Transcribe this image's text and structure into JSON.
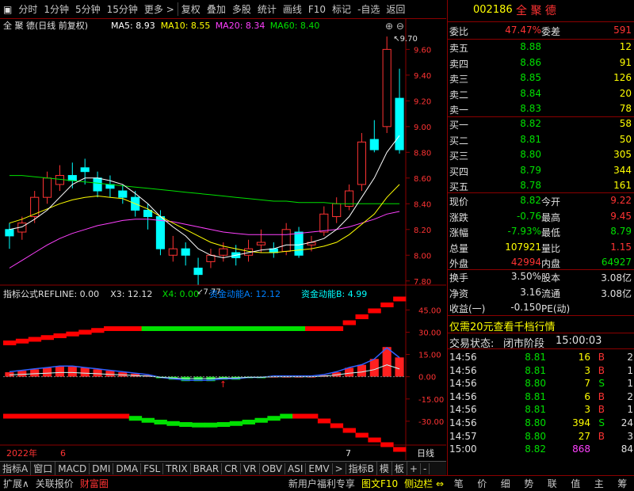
{
  "toolbar": {
    "items": [
      "分时",
      "1分钟",
      "5分钟",
      "15分钟",
      "更多 >",
      "复权",
      "叠加",
      "多股",
      "统计",
      "画线",
      "F10",
      "标记",
      "-自选",
      "返回"
    ]
  },
  "chart": {
    "name": "全 聚 德(日线 前复权)",
    "ma": [
      {
        "label": "MA5: 8.93",
        "color": "#ffffff"
      },
      {
        "label": "MA10: 8.55",
        "color": "#ffff00"
      },
      {
        "label": "MA20: 8.34",
        "color": "#ff40ff"
      },
      {
        "label": "MA60: 8.40",
        "color": "#00e000"
      }
    ],
    "high_label": "9.70",
    "low_label": "7.77",
    "price_ticks": [
      "9.60",
      "9.40",
      "9.20",
      "9.00",
      "8.80",
      "8.60",
      "8.40",
      "8.20",
      "8.00",
      "7.80"
    ],
    "ind_header": {
      "name": "指标公式",
      "refline": "REFLINE: 0.00",
      "x3": "X3: 12.12",
      "x4": "X4: 0.00",
      "a": "资金动能A: 12.12",
      "b": "资金动能B: 4.99"
    },
    "ind_ticks": [
      "45.00",
      "30.00",
      "15.00",
      "0.00",
      "-15.00",
      "-30.00"
    ],
    "date_year": "2022年",
    "date_m6": "6",
    "date_m7": "7",
    "period": "日线"
  },
  "chart_data": {
    "type": "candlestick",
    "ohlc": [
      [
        8.2,
        8.15,
        8.25,
        8.05
      ],
      [
        8.18,
        8.25,
        8.3,
        8.12
      ],
      [
        8.3,
        8.45,
        8.5,
        8.25
      ],
      [
        8.45,
        8.6,
        8.65,
        8.4
      ],
      [
        8.55,
        8.62,
        8.7,
        8.5
      ],
      [
        8.62,
        8.58,
        8.72,
        8.52
      ],
      [
        8.68,
        8.65,
        8.75,
        8.55
      ],
      [
        8.6,
        8.5,
        8.65,
        8.45
      ],
      [
        8.55,
        8.52,
        8.62,
        8.45
      ],
      [
        8.5,
        8.45,
        8.55,
        8.4
      ],
      [
        8.45,
        8.35,
        8.5,
        8.3
      ],
      [
        8.35,
        8.3,
        8.4,
        8.2
      ],
      [
        8.3,
        8.05,
        8.35,
        8.0
      ],
      [
        8.0,
        8.05,
        8.15,
        7.95
      ],
      [
        8.05,
        8.0,
        8.1,
        7.92
      ],
      [
        7.9,
        7.85,
        7.98,
        7.77
      ],
      [
        7.95,
        8.0,
        8.05,
        7.9
      ],
      [
        8.0,
        8.05,
        8.1,
        7.95
      ],
      [
        8.02,
        7.98,
        8.08,
        7.92
      ],
      [
        8.0,
        8.05,
        8.12,
        7.95
      ],
      [
        8.08,
        8.1,
        8.2,
        8.02
      ],
      [
        8.05,
        8.02,
        8.1,
        7.98
      ],
      [
        8.03,
        8.2,
        8.25,
        8.0
      ],
      [
        8.18,
        8.0,
        8.22,
        7.98
      ],
      [
        8.08,
        8.1,
        8.15,
        8.03
      ],
      [
        8.18,
        8.32,
        8.38,
        8.15
      ],
      [
        8.3,
        8.4,
        8.45,
        8.25
      ],
      [
        8.38,
        8.5,
        8.55,
        8.35
      ],
      [
        8.55,
        8.88,
        8.95,
        8.5
      ],
      [
        8.9,
        8.82,
        9.05,
        8.8
      ],
      [
        9.0,
        9.6,
        9.7,
        8.95
      ],
      [
        9.22,
        8.82,
        9.45,
        8.79
      ]
    ],
    "ma5": [
      8.2,
      8.22,
      8.28,
      8.35,
      8.45,
      8.55,
      8.6,
      8.6,
      8.58,
      8.55,
      8.48,
      8.4,
      8.3,
      8.22,
      8.15,
      8.05,
      8.0,
      7.98,
      8.0,
      8.02,
      8.04,
      8.05,
      8.08,
      8.08,
      8.1,
      8.13,
      8.2,
      8.3,
      8.45,
      8.6,
      8.8,
      8.93
    ],
    "ma10": [
      8.25,
      8.28,
      8.32,
      8.36,
      8.4,
      8.43,
      8.45,
      8.46,
      8.45,
      8.44,
      8.4,
      8.36,
      8.3,
      8.25,
      8.2,
      8.15,
      8.1,
      8.07,
      8.05,
      8.03,
      8.02,
      8.02,
      8.03,
      8.04,
      8.05,
      8.07,
      8.1,
      8.16,
      8.24,
      8.32,
      8.45,
      8.55
    ],
    "ma20": [
      7.9,
      7.96,
      8.02,
      8.08,
      8.13,
      8.17,
      8.2,
      8.23,
      8.25,
      8.27,
      8.28,
      8.28,
      8.27,
      8.26,
      8.24,
      8.22,
      8.2,
      8.18,
      8.17,
      8.16,
      8.16,
      8.16,
      8.16,
      8.17,
      8.18,
      8.19,
      8.2,
      8.22,
      8.25,
      8.28,
      8.32,
      8.34
    ],
    "ma60": [
      8.62,
      8.62,
      8.61,
      8.6,
      8.59,
      8.58,
      8.57,
      8.56,
      8.55,
      8.54,
      8.53,
      8.52,
      8.51,
      8.5,
      8.49,
      8.48,
      8.47,
      8.46,
      8.45,
      8.44,
      8.43,
      8.42,
      8.42,
      8.41,
      8.41,
      8.41,
      8.4,
      8.4,
      8.4,
      8.4,
      8.4,
      8.4
    ],
    "price_range": [
      7.7,
      9.75
    ],
    "ind_range": [
      -45,
      50
    ]
  },
  "quote": {
    "code": "002186",
    "name": "全 聚 德",
    "weibi_label": "委比",
    "weibi": "47.47%",
    "weicha_label": "委差",
    "weicha": "591",
    "asks": [
      {
        "label": "卖五",
        "price": "8.88",
        "vol": "12"
      },
      {
        "label": "卖四",
        "price": "8.86",
        "vol": "91"
      },
      {
        "label": "卖三",
        "price": "8.85",
        "vol": "126"
      },
      {
        "label": "卖二",
        "price": "8.84",
        "vol": "20"
      },
      {
        "label": "卖一",
        "price": "8.83",
        "vol": "78"
      }
    ],
    "bids": [
      {
        "label": "买一",
        "price": "8.82",
        "vol": "58"
      },
      {
        "label": "买二",
        "price": "8.81",
        "vol": "50"
      },
      {
        "label": "买三",
        "price": "8.80",
        "vol": "305"
      },
      {
        "label": "买四",
        "price": "8.79",
        "vol": "344"
      },
      {
        "label": "买五",
        "price": "8.78",
        "vol": "161"
      }
    ],
    "stats": [
      {
        "l1": "现价",
        "v1": "8.82",
        "c1": "g",
        "l2": "今开",
        "v2": "9.22",
        "c2": "r"
      },
      {
        "l1": "涨跌",
        "v1": "-0.76",
        "c1": "g",
        "l2": "最高",
        "v2": "9.45",
        "c2": "r"
      },
      {
        "l1": "涨幅",
        "v1": "-7.93%",
        "c1": "g",
        "l2": "最低",
        "v2": "8.79",
        "c2": "g"
      },
      {
        "l1": "总量",
        "v1": "107921",
        "c1": "y",
        "l2": "量比",
        "v2": "1.15",
        "c2": "r"
      },
      {
        "l1": "外盘",
        "v1": "42994",
        "c1": "r",
        "l2": "内盘",
        "v2": "64927",
        "c2": "g"
      }
    ],
    "fin": [
      {
        "l1": "换手",
        "v1": "3.50%",
        "l2": "股本",
        "v2": "3.08亿"
      },
      {
        "l1": "净资",
        "v1": "3.16",
        "l2": "流通",
        "v2": "3.08亿"
      },
      {
        "l1": "收益(一)",
        "v1": "-0.150",
        "l2": "PE(动)",
        "v2": ""
      }
    ],
    "promo": "仅需20元查看千档行情",
    "trade_state_label": "交易状态:",
    "trade_state": "闭市阶段",
    "trade_time": "15:00:03",
    "ticks": [
      {
        "t": "14:56",
        "p": "8.81",
        "v": "16",
        "s": "B",
        "n": "2",
        "pc": "g",
        "vc": "y",
        "sc": "r"
      },
      {
        "t": "14:56",
        "p": "8.81",
        "v": "3",
        "s": "B",
        "n": "1",
        "pc": "g",
        "vc": "y",
        "sc": "r"
      },
      {
        "t": "14:56",
        "p": "8.80",
        "v": "7",
        "s": "S",
        "n": "1",
        "pc": "g",
        "vc": "y",
        "sc": "g"
      },
      {
        "t": "14:56",
        "p": "8.81",
        "v": "6",
        "s": "B",
        "n": "2",
        "pc": "g",
        "vc": "y",
        "sc": "r"
      },
      {
        "t": "14:56",
        "p": "8.81",
        "v": "3",
        "s": "B",
        "n": "1",
        "pc": "g",
        "vc": "y",
        "sc": "r"
      },
      {
        "t": "14:56",
        "p": "8.80",
        "v": "394",
        "s": "S",
        "n": "24",
        "pc": "g",
        "vc": "y",
        "sc": "g"
      },
      {
        "t": "14:57",
        "p": "8.80",
        "v": "27",
        "s": "B",
        "n": "3",
        "pc": "g",
        "vc": "y",
        "sc": "r"
      },
      {
        "t": "15:00",
        "p": "8.82",
        "v": "868",
        "s": "",
        "n": "84",
        "pc": "g",
        "vc": "m",
        "sc": "w"
      }
    ],
    "bottom_tabs": [
      "笔",
      "价",
      "细",
      "势",
      "联",
      "值",
      "主",
      "筹"
    ]
  },
  "tabs": [
    "指标A",
    "窗口",
    "MACD",
    "DMI",
    "DMA",
    "FSL",
    "TRIX",
    "BRAR",
    "CR",
    "VR",
    "OBV",
    "ASI",
    "EMV",
    ">",
    "指标B",
    "模",
    "板",
    "+",
    "-"
  ],
  "statusbar": {
    "items": [
      "扩展∧",
      "关联报价",
      "财富圈"
    ],
    "right": [
      "新用户福利专享",
      "图文F10",
      "侧边栏 ⇔"
    ]
  }
}
